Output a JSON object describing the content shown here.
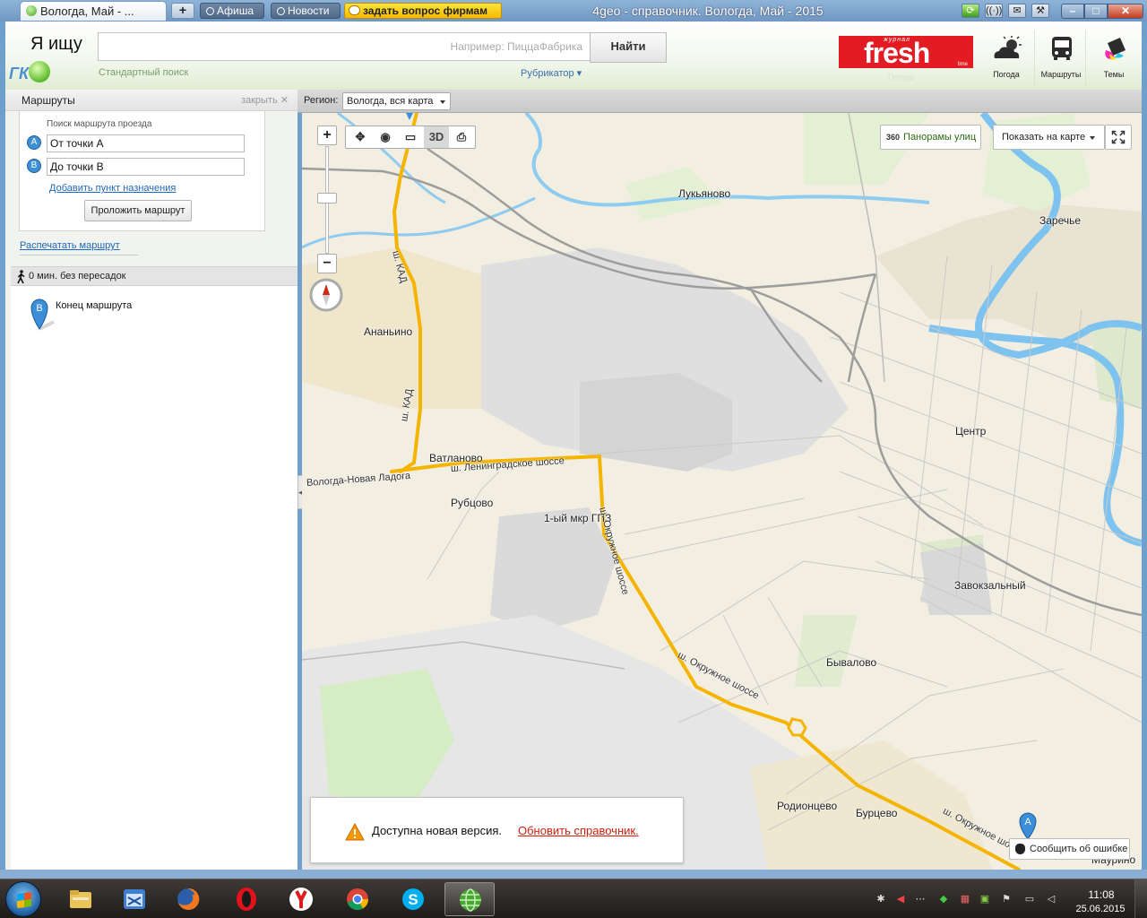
{
  "window": {
    "tab_title": "Вологда, Май - ...",
    "new_tab": "+",
    "afisha_tab": "Афиша",
    "news_tab": "Новости",
    "ask_tab": "задать вопрос фирмам",
    "title": "4geo - справочник. Вологда, Май - 2015"
  },
  "header": {
    "search_label": "Я ищу",
    "search_value": "",
    "search_placeholder": "Например: ПиццаФабрика",
    "find_button": "Найти",
    "standard_search": "Стандартный поиск",
    "rubricator": "Рубрикатор",
    "banner_small": "журнал",
    "banner_big": "fresh",
    "banner_time": "time",
    "banner_shadow": "Погода",
    "quick": [
      {
        "label": "Погода",
        "icon": "weather-icon"
      },
      {
        "label": "Маршруты",
        "icon": "bus-icon"
      },
      {
        "label": "Темы",
        "icon": "paint-bucket-icon"
      }
    ]
  },
  "routes": {
    "title": "Маршруты",
    "close": "закрыть",
    "search_label": "Поиск маршрута проезда",
    "point_a_badge": "A",
    "point_b_badge": "B",
    "point_a_value": "От точки А",
    "point_b_value": "До точки В",
    "add_destination": "Добавить пункт назначения",
    "build_button": "Проложить маршрут",
    "print_link": "Распечатать маршрут",
    "summary": "0 мин. без пересадок",
    "end_badge": "B",
    "end_label": "Конец маршрута"
  },
  "map": {
    "region_label": "Регион:",
    "region_value": "Вологда, вся карта",
    "zoom_in": "+",
    "zoom_out": "−",
    "btn_3d": "3D",
    "panorama_tag": "360",
    "panorama": "Панорамы улиц",
    "show_on_map": "Показать на карте",
    "start_marker": "A",
    "places": [
      {
        "name": "Лукьяново"
      },
      {
        "name": "Заречье"
      },
      {
        "name": "Ананьино"
      },
      {
        "name": "Центр"
      },
      {
        "name": "Ватланово"
      },
      {
        "name": "Рубцово"
      },
      {
        "name": "1-ый мкр ГПЗ"
      },
      {
        "name": "Завокзальный"
      },
      {
        "name": "Бывалово"
      },
      {
        "name": "Родионцево"
      },
      {
        "name": "Бурцево"
      },
      {
        "name": "Маурино"
      }
    ],
    "roads": [
      {
        "name": "ш. КАД"
      },
      {
        "name": "ш. КАД"
      },
      {
        "name": "Вологда-Новая Ладога"
      },
      {
        "name": "ш. Ленинградское шоссе"
      },
      {
        "name": "ш. Окружное шоссе"
      },
      {
        "name": "ш. Окружное шоссе"
      },
      {
        "name": "ш. Окружное шоссе"
      }
    ],
    "notice_text": "Доступна новая версия.",
    "notice_link": "Обновить справочник.",
    "report_error": "Сообщить об ошибке"
  },
  "taskbar": {
    "apps": [
      {
        "name": "explorer",
        "icon": "folder-icon"
      },
      {
        "name": "app",
        "icon": "blue-window-icon"
      },
      {
        "name": "firefox",
        "icon": "firefox-icon"
      },
      {
        "name": "opera",
        "icon": "opera-icon"
      },
      {
        "name": "yandex",
        "icon": "yandex-icon"
      },
      {
        "name": "chrome",
        "icon": "chrome-icon"
      },
      {
        "name": "skype",
        "icon": "skype-icon"
      },
      {
        "name": "4geo",
        "icon": "globe-icon"
      }
    ],
    "time": "11:08",
    "date": "25.06.2015"
  }
}
